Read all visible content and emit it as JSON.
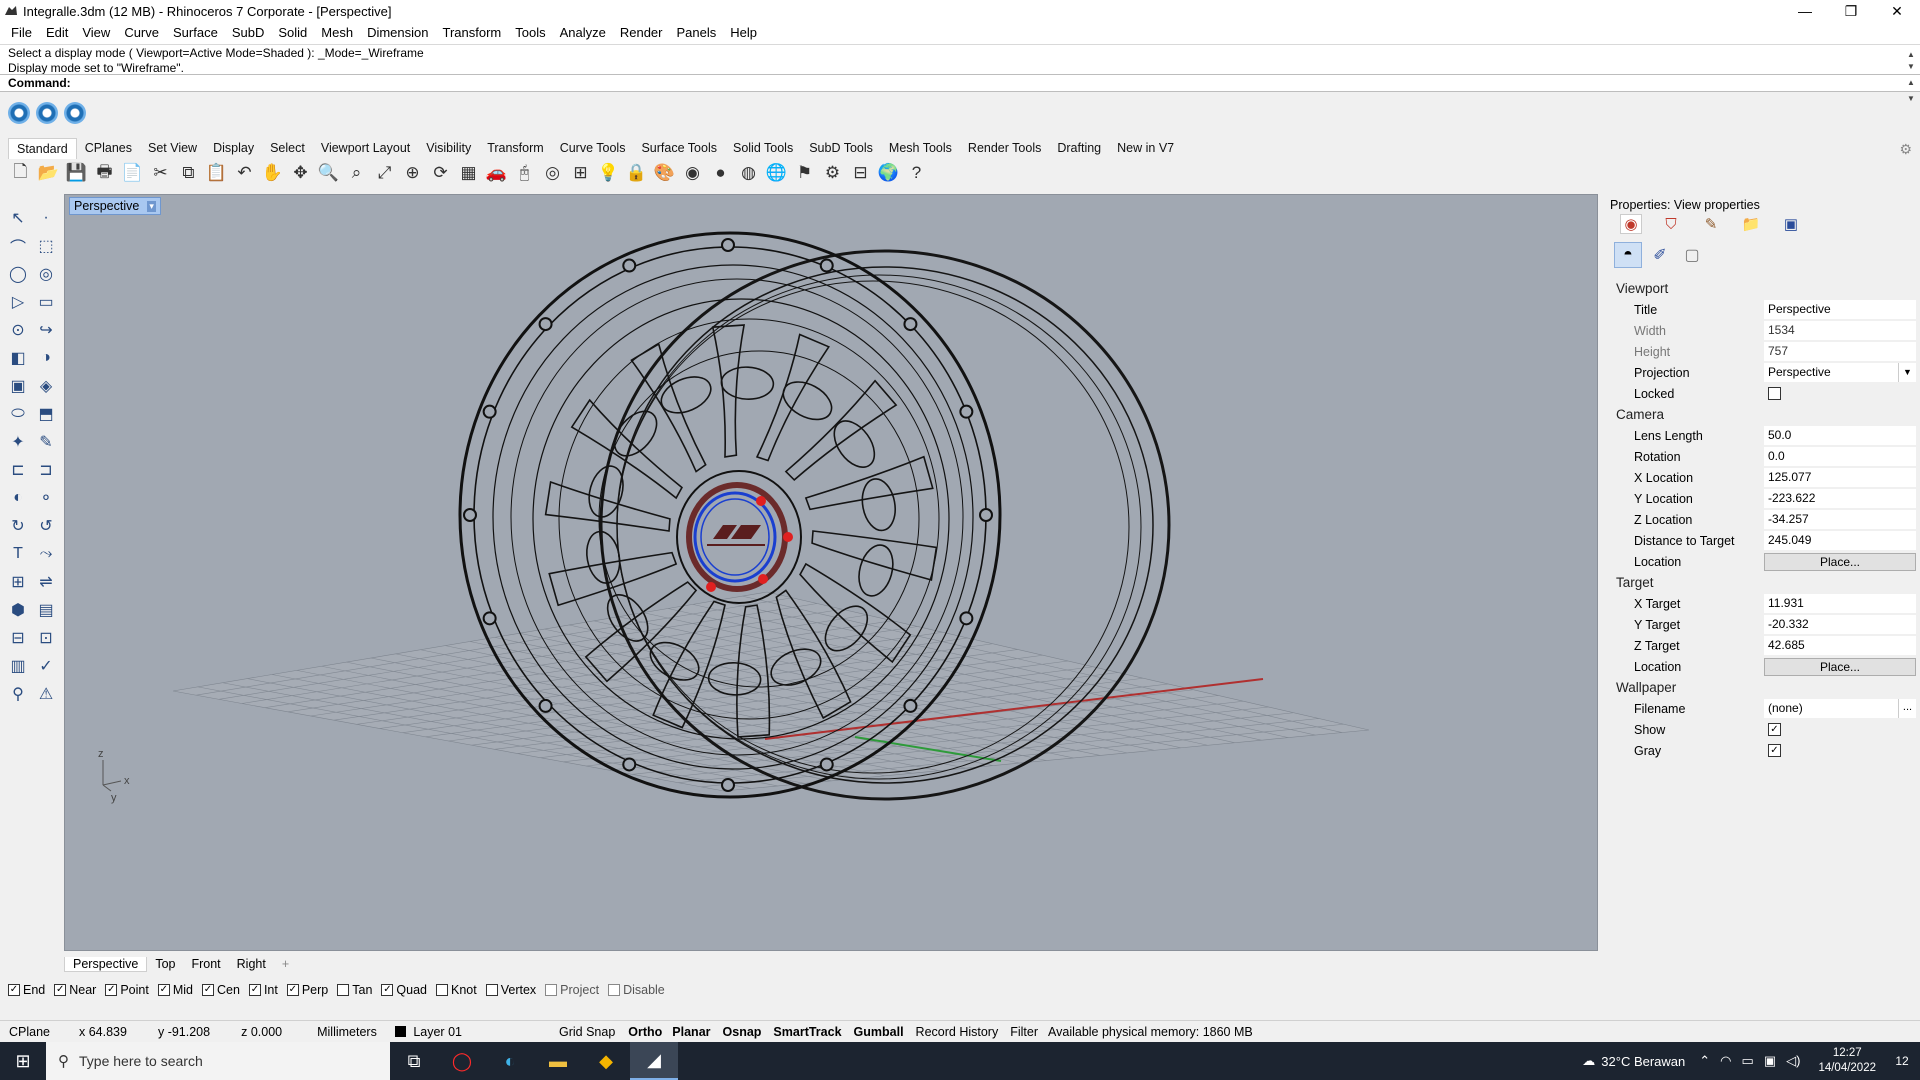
{
  "window": {
    "title": "Integralle.3dm (12 MB) - Rhinoceros 7 Corporate - [Perspective]",
    "controls": [
      "—",
      "❐",
      "✕"
    ]
  },
  "menu": [
    "File",
    "Edit",
    "View",
    "Curve",
    "Surface",
    "SubD",
    "Solid",
    "Mesh",
    "Dimension",
    "Transform",
    "Tools",
    "Analyze",
    "Render",
    "Panels",
    "Help"
  ],
  "command": {
    "history_line1": "Select a display mode ( Viewport=Active  Mode=Shaded ): _Mode=_Wireframe",
    "history_line2": "Display mode set to \"Wireframe\".",
    "prompt": "Command:"
  },
  "toolbar_tabs": [
    "Standard",
    "CPlanes",
    "Set View",
    "Display",
    "Select",
    "Viewport Layout",
    "Visibility",
    "Transform",
    "Curve Tools",
    "Surface Tools",
    "Solid Tools",
    "SubD Tools",
    "Mesh Tools",
    "Render Tools",
    "Drafting",
    "New in V7"
  ],
  "standard_icons": [
    "new-icon",
    "open-icon",
    "save-icon",
    "print-icon",
    "import-icon",
    "cut-icon",
    "copy-icon",
    "paste-icon",
    "undo-icon",
    "pan-icon",
    "move-view-icon",
    "zoom-icon",
    "zoom-window-icon",
    "zoom-extents-icon",
    "zoom-selected-icon",
    "rotate-view-icon",
    "grid-icon",
    "car-icon",
    "mouse-icon",
    "circle-icon",
    "pack-icon",
    "light-icon",
    "lock-icon",
    "color-icon",
    "color-wheel-icon",
    "sphere-icon",
    "sphere-shaded-icon",
    "sphere-blue-icon",
    "gumball-icon",
    "gear-icon",
    "snap-icon",
    "globe-icon",
    "help-icon"
  ],
  "standard_icon_glyphs": [
    "🗋",
    "📂",
    "💾",
    "🖶",
    "📄",
    "✂",
    "⧉",
    "📋",
    "↶",
    "✋",
    "✥",
    "🔍",
    "⌕",
    "⤢",
    "⊕",
    "⟳",
    "▦",
    "🚗",
    "🖰",
    "◎",
    "⊞",
    "💡",
    "🔒",
    "🎨",
    "◉",
    "●",
    "◍",
    "🌐",
    "⚑",
    "⚙",
    "⊟",
    "🌍",
    "?"
  ],
  "left_tools": [
    "↖",
    "·",
    "⌒",
    "⬚",
    "◯",
    "◎",
    "▷",
    "▭",
    "⊙",
    "↪",
    "◧",
    "◑",
    "▣",
    "◈",
    "⬭",
    "⬒",
    "✦",
    "✎",
    "⊏",
    "⊐",
    "◐",
    "⚬",
    "↻",
    "↺",
    "T",
    "⤳",
    "⊞",
    "⇌",
    "⬢",
    "▤",
    "⊟",
    "⊡",
    "▥",
    "✓",
    "⚲",
    "⚠"
  ],
  "viewport": {
    "label": "Perspective",
    "axis_labels": [
      "z",
      "x",
      "y"
    ]
  },
  "viewport_tabs": [
    "Perspective",
    "Top",
    "Front",
    "Right"
  ],
  "viewport_add": "+",
  "osnaps": [
    {
      "label": "End",
      "checked": true,
      "dim": false
    },
    {
      "label": "Near",
      "checked": true,
      "dim": false
    },
    {
      "label": "Point",
      "checked": true,
      "dim": false
    },
    {
      "label": "Mid",
      "checked": true,
      "dim": false
    },
    {
      "label": "Cen",
      "checked": true,
      "dim": false
    },
    {
      "label": "Int",
      "checked": true,
      "dim": false
    },
    {
      "label": "Perp",
      "checked": true,
      "dim": false
    },
    {
      "label": "Tan",
      "checked": false,
      "dim": false
    },
    {
      "label": "Quad",
      "checked": true,
      "dim": false
    },
    {
      "label": "Knot",
      "checked": false,
      "dim": false
    },
    {
      "label": "Vertex",
      "checked": false,
      "dim": false
    },
    {
      "label": "Project",
      "checked": false,
      "dim": true
    },
    {
      "label": "Disable",
      "checked": false,
      "dim": true
    }
  ],
  "status": {
    "cplane": "CPlane",
    "x": "x 64.839",
    "y": "y -91.208",
    "z": "z 0.000",
    "units": "Millimeters",
    "layer": "Layer 01",
    "grid_snap": "Grid Snap",
    "ortho": "Ortho",
    "planar": "Planar",
    "osnap": "Osnap",
    "smarttrack": "SmartTrack",
    "gumball": "Gumball",
    "record_history": "Record History",
    "filter": "Filter",
    "memory": "Available physical memory: 1860 MB"
  },
  "properties": {
    "title": "Properties: View properties",
    "sections": {
      "viewport": "Viewport",
      "camera": "Camera",
      "target": "Target",
      "wallpaper": "Wallpaper"
    },
    "viewport": {
      "title_label": "Title",
      "title_value": "Perspective",
      "width_label": "Width",
      "width_value": "1534",
      "height_label": "Height",
      "height_value": "757",
      "projection_label": "Projection",
      "projection_value": "Perspective",
      "locked_label": "Locked",
      "locked": false
    },
    "camera": {
      "lens_label": "Lens Length",
      "lens_value": "50.0",
      "rotation_label": "Rotation",
      "rotation_value": "0.0",
      "x_label": "X Location",
      "x_value": "125.077",
      "y_label": "Y Location",
      "y_value": "-223.622",
      "z_label": "Z Location",
      "z_value": "-34.257",
      "dist_label": "Distance to Target",
      "dist_value": "245.049",
      "loc_label": "Location",
      "loc_button": "Place..."
    },
    "target": {
      "x_label": "X Target",
      "x_value": "11.931",
      "y_label": "Y Target",
      "y_value": "-20.332",
      "z_label": "Z Target",
      "z_value": "42.685",
      "loc_label": "Location",
      "loc_button": "Place..."
    },
    "wallpaper": {
      "filename_label": "Filename",
      "filename_value": "(none)",
      "filename_button": "...",
      "show_label": "Show",
      "show": true,
      "gray_label": "Gray",
      "gray": true
    }
  },
  "taskbar": {
    "search_placeholder": "Type here to search",
    "weather": "32°C  Berawan",
    "time": "12:27",
    "date": "14/04/2022",
    "notifications": "12"
  },
  "colors": {
    "viewport_bg": "#a1a8b2",
    "viewport_tab": "#a9c8f0",
    "taskbar": "#1c2430",
    "accent_red": "#e02020",
    "accent_blue": "#1a3fd0"
  }
}
